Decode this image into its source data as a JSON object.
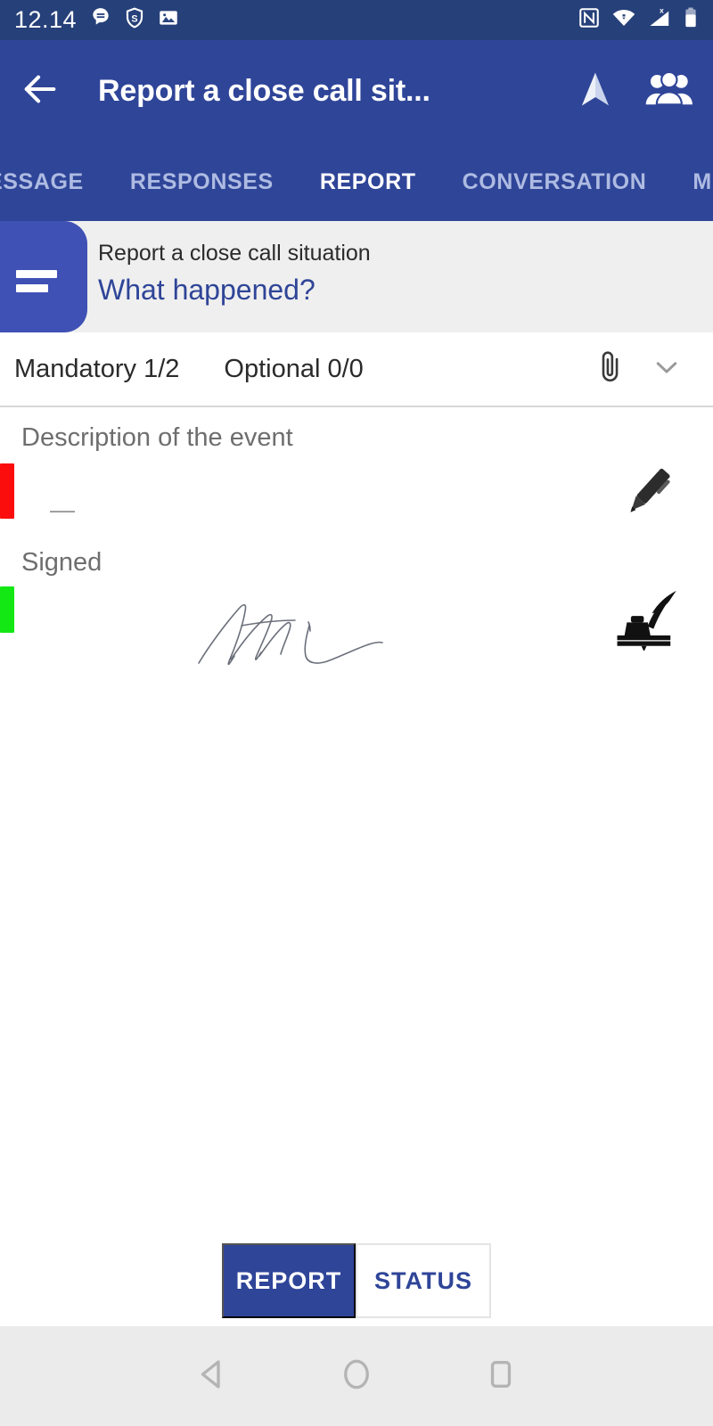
{
  "statusbar": {
    "clock": "12.14",
    "left_icons": [
      "message-bubble-icon",
      "shield-s-icon",
      "image-icon"
    ],
    "right_icons": [
      "nfc-icon",
      "wifi-icon",
      "cellular-signal-x-icon",
      "battery-icon"
    ]
  },
  "appbar": {
    "back_icon": "back-arrow-icon",
    "title": "Report a close call sit...",
    "navigate_icon": "navigation-arrow-icon",
    "people_icon": "people-group-icon"
  },
  "tabs": [
    {
      "label": "ESSAGE",
      "active": false
    },
    {
      "label": "RESPONSES",
      "active": false
    },
    {
      "label": "REPORT",
      "active": true
    },
    {
      "label": "CONVERSATION",
      "active": false
    },
    {
      "label": "M",
      "active": false
    }
  ],
  "question_header": {
    "lines_icon": "list-lines-icon",
    "subtitle": "Report a close call situation",
    "title": "What happened?"
  },
  "counters": {
    "mandatory": "Mandatory 1/2",
    "optional": "Optional 0/0",
    "attach_icon": "paperclip-icon",
    "collapse_icon": "chevron-down-icon"
  },
  "fields": [
    {
      "label": "Description of the event",
      "value": "—",
      "status_color": "#fb0d0d",
      "action_icon": "pen-icon",
      "has_signature": false
    },
    {
      "label": "Signed",
      "value": "",
      "status_color": "#14e814",
      "action_icon": "quill-inkwell-icon",
      "has_signature": true
    }
  ],
  "bottom_buttons": {
    "primary": "REPORT",
    "secondary": "STATUS"
  },
  "navbar": {
    "back": "nav-back-triangle-icon",
    "home": "nav-home-circle-icon",
    "recents": "nav-recents-square-icon"
  },
  "colors": {
    "statusbar_blue": "#264079",
    "appbar_blue": "#2F4598",
    "accent_blue": "#3F51B5",
    "panel_gray": "#EFEFEF",
    "tab_inactive": "#AEBBE2",
    "mandatory_red": "#fb0d0d",
    "signed_green": "#14e814"
  }
}
